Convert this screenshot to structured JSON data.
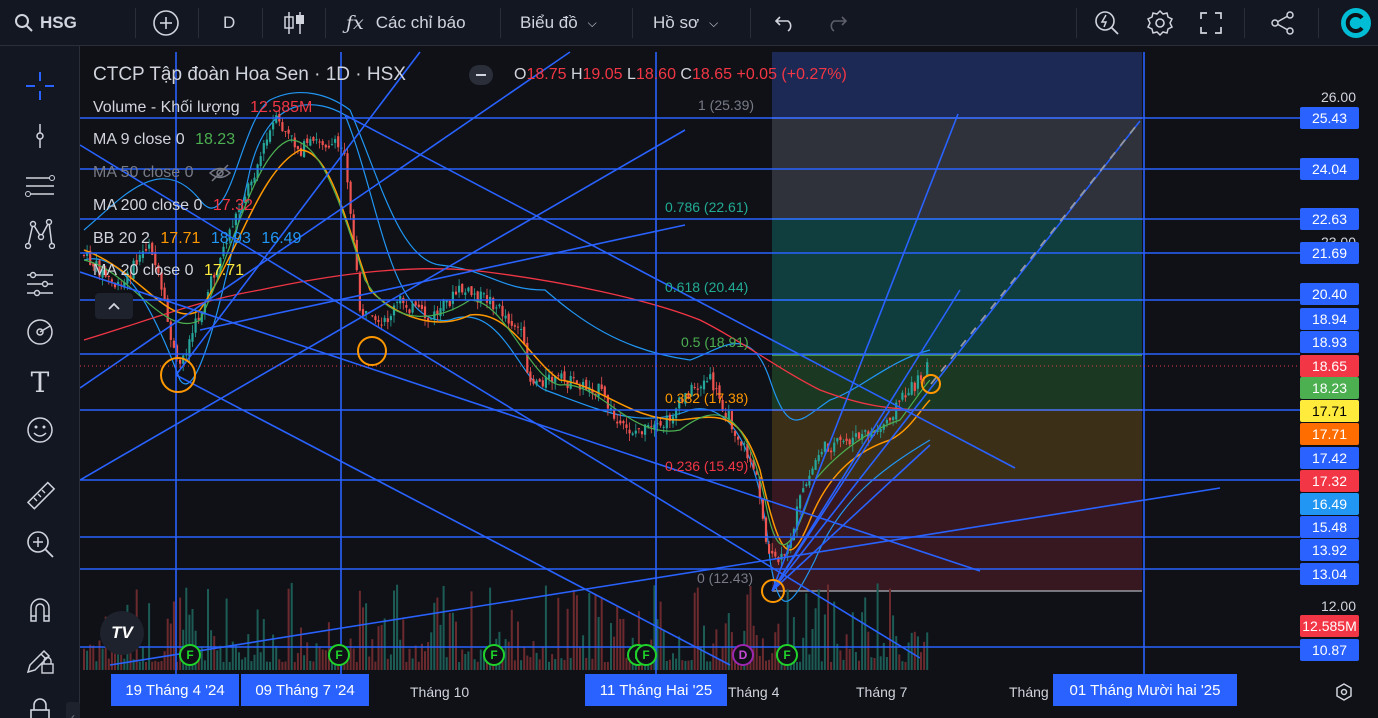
{
  "topbar": {
    "symbol": "HSG",
    "interval": "D",
    "indicators_label": "Các chỉ báo",
    "chart_label": "Biểu đồ",
    "profile_label": "Hồ sơ"
  },
  "legend": {
    "title": "CTCP Tập đoàn Hoa Sen · 1D · HSX",
    "o_label": "O",
    "o_value": "18.75",
    "h_label": "H",
    "h_value": "19.05",
    "l_label": "L",
    "l_value": "18.60",
    "c_label": "C",
    "c_value": "18.65",
    "change": "+0.05 (+0.27%)",
    "volume_label": "Volume - Khối lượng",
    "volume_value": "12.585M",
    "ma9_label": "MA 9 close 0",
    "ma9_value": "18.23",
    "ma50_label": "MA 50 close 0",
    "ma200_label": "MA 200 close 0",
    "ma200_value": "17.32",
    "bb_label": "BB 20 2",
    "bb_mid": "17.71",
    "bb_up": "18.93",
    "bb_low": "16.49",
    "ma20_label": "MA 20 close 0",
    "ma20_value": "17.71"
  },
  "fib_levels": [
    {
      "label": "1 (25.39)",
      "color": "#787b86"
    },
    {
      "label": "0.786 (22.61)",
      "color": "#22ab94"
    },
    {
      "label": "0.618 (20.44)",
      "color": "#22ab94"
    },
    {
      "label": "0.5 (18.91)",
      "color": "#4caf50"
    },
    {
      "label": "0.382 (17.38)",
      "color": "#ff9800"
    },
    {
      "label": "0.236 (15.49)",
      "color": "#f23645"
    },
    {
      "label": "0 (12.43)",
      "color": "#787b86"
    }
  ],
  "price_axis": {
    "ticks": [
      "26.00",
      "23.00",
      "12.00"
    ],
    "labels": [
      {
        "text": "25.43",
        "color": "#2962ff"
      },
      {
        "text": "24.04",
        "color": "#2962ff"
      },
      {
        "text": "22.63",
        "color": "#2962ff"
      },
      {
        "text": "21.69",
        "color": "#2962ff"
      },
      {
        "text": "20.40",
        "color": "#2962ff"
      },
      {
        "text": "18.94",
        "color": "#2962ff"
      },
      {
        "text": "18.93",
        "color": "#2962ff"
      },
      {
        "text": "18.65",
        "color": "#f23645"
      },
      {
        "text": "18.23",
        "color": "#4caf50"
      },
      {
        "text": "17.71",
        "color": "#ffeb3b"
      },
      {
        "text": "17.71",
        "color": "#ff6d00"
      },
      {
        "text": "17.42",
        "color": "#2962ff"
      },
      {
        "text": "17.32",
        "color": "#f23645"
      },
      {
        "text": "16.49",
        "color": "#2196f3"
      },
      {
        "text": "15.48",
        "color": "#2962ff"
      },
      {
        "text": "13.92",
        "color": "#2962ff"
      },
      {
        "text": "13.04",
        "color": "#2962ff"
      },
      {
        "text": "12.585M",
        "color": "#f23645"
      },
      {
        "text": "10.87",
        "color": "#2962ff"
      }
    ]
  },
  "time_axis": {
    "ticks": [
      "Tháng 10",
      "Tháng 4",
      "Tháng 7",
      "Tháng"
    ],
    "highlights": [
      "19 Tháng 4 '24",
      "09 Tháng 7 '24",
      "11 Tháng Hai '25",
      "01 Tháng Mười hai '25"
    ]
  },
  "events": {
    "earnings": "F",
    "dividend": "D"
  },
  "logo_text": "TV"
}
